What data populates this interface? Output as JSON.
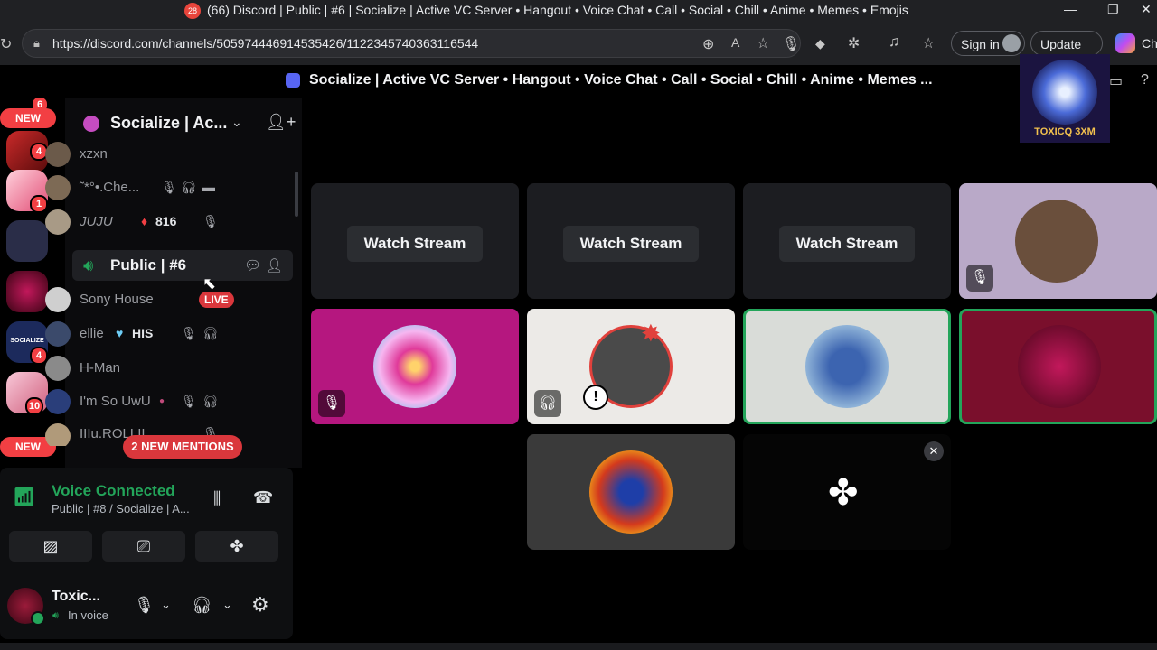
{
  "browser": {
    "title": "(66) Discord | Public | #6 | Socialize | Active VC Server • Hangout • Voice Chat • Call • Social • Chill • Anime • Memes • Emojis",
    "tab_badge": "28",
    "url": "https://discord.com/channels/505974446914535426/1122345740363116544",
    "sign_in_label": "Sign in",
    "update_label": "Update",
    "copilot_label": "Ch"
  },
  "channel_header": {
    "title": "Socialize | Active VC Server • Hangout • Voice Chat • Call • Social • Chill • Anime • Memes ..."
  },
  "overlay": {
    "label": "TOXICQ 3XM"
  },
  "rail": {
    "new_top": "NEW",
    "new_bottom": "NEW",
    "top_count": "6",
    "badges": [
      "4",
      "1",
      "4",
      "10"
    ],
    "socialize_label": "SOCIALIZE"
  },
  "server": {
    "name": "Socialize | Ac..."
  },
  "members_above": [
    {
      "name": "xzxn"
    },
    {
      "name": "˜*°•.Che..."
    },
    {
      "name": "JUJU",
      "badge": "816"
    }
  ],
  "channel": {
    "name": "Public | #6"
  },
  "members": [
    {
      "name": "Sony House",
      "tag": "LIVE"
    },
    {
      "name": "ellie",
      "tag": "HIS"
    },
    {
      "name": "H-Man"
    },
    {
      "name": "I'm So UwU"
    },
    {
      "name": "IIIu.ROLLII"
    }
  ],
  "mentions_label": "2 NEW MENTIONS",
  "voice": {
    "status": "Voice Connected",
    "location": "Public | #8 / Socialize | A..."
  },
  "user": {
    "name": "Toxic...",
    "status": "In voice"
  },
  "tiles": {
    "watch_label": "Watch Stream"
  },
  "colors": {
    "accent_green": "#23a55a",
    "live_red": "#da373c",
    "pink_tile": "#b5177f",
    "maroon_tile": "#7a0f2c"
  }
}
